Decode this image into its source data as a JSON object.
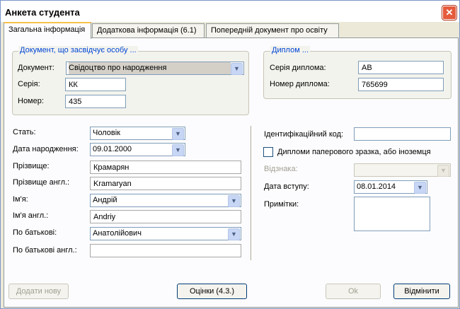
{
  "window": {
    "title": "Анкета студента"
  },
  "tabs": [
    {
      "label": "Загальна інформація"
    },
    {
      "label": "Додаткова інформація (6.1)"
    },
    {
      "label": "Попередній документ про освіту"
    }
  ],
  "identity_group": {
    "legend": "Документ, що засвідчує особу ...",
    "document_label": "Документ:",
    "document_value": "Свідоцтво про народження",
    "series_label": "Серія:",
    "series_value": "КК",
    "number_label": "Номер:",
    "number_value": "435"
  },
  "diploma_group": {
    "legend": "Диплом ...",
    "series_label": "Серія диплома:",
    "series_value": "АВ",
    "number_label": "Номер диплома:",
    "number_value": "765699"
  },
  "personal": {
    "gender_label": "Стать:",
    "gender_value": "Чоловік",
    "birth_label": "Дата народження:",
    "birth_value": "09.01.2000",
    "surname_label": "Прізвище:",
    "surname_value": "Крамарян",
    "surname_en_label": "Прізвище англ.:",
    "surname_en_value": "Kramaryan",
    "name_label": "Ім'я:",
    "name_value": "Андрій",
    "name_en_label": "Ім'я англ.:",
    "name_en_value": "Andriy",
    "patronymic_label": "По батькові:",
    "patronymic_value": "Анатолійович",
    "patronymic_en_label": "По батькові англ.:",
    "patronymic_en_value": ""
  },
  "right": {
    "id_code_label": "Ідентифікаційний код:",
    "id_code_value": "",
    "paper_diploma_label": "Дипломи паперового зразка, або іноземця",
    "distinction_label": "Відзнака:",
    "distinction_value": "",
    "entry_date_label": "Дата вступу:",
    "entry_date_value": "08.01.2014",
    "notes_label": "Примітки:",
    "notes_value": ""
  },
  "buttons": {
    "add_new": "Додати нову",
    "grades": "Оцінки (4.3.)",
    "ok": "Ok",
    "cancel": "Відмінити"
  },
  "icons": {
    "close": "close-icon",
    "dropdown": "chevron-down-icon"
  },
  "colors": {
    "close_button": "#e55b3c",
    "tab_highlight": "#f7c24b",
    "legend_text": "#0046d5"
  }
}
